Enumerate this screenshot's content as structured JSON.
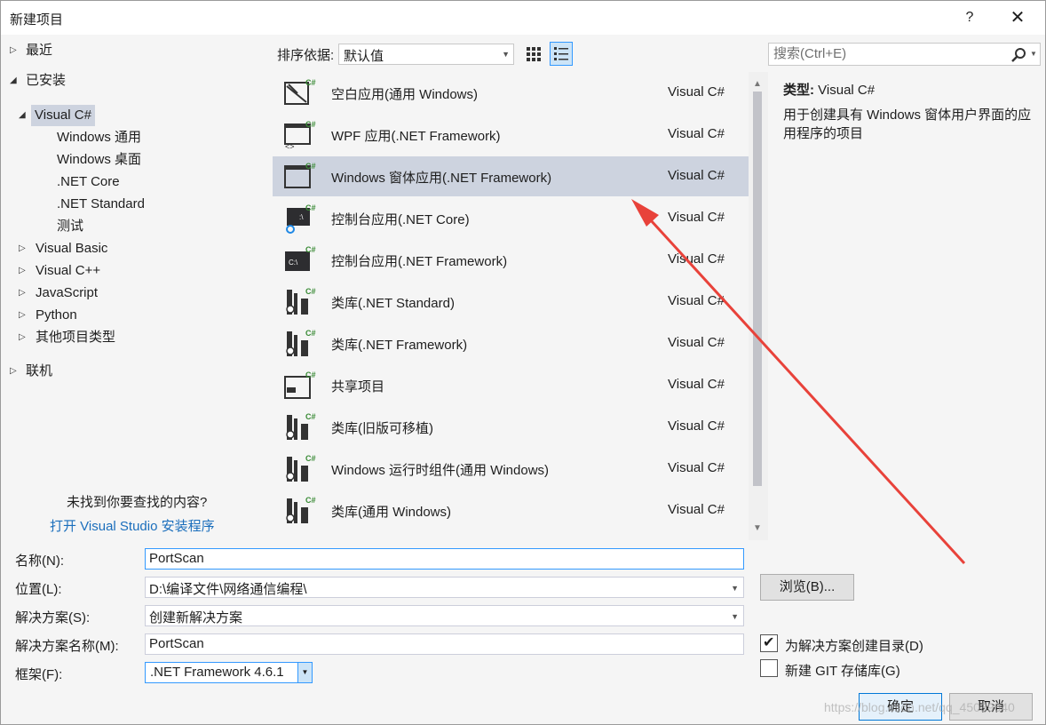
{
  "window": {
    "title": "新建项目",
    "help": "?",
    "close": "✕"
  },
  "tree": {
    "recent": "最近",
    "installed": "已安装",
    "visual_csharp": "Visual C#",
    "children": [
      "Windows 通用",
      "Windows 桌面",
      ".NET Core",
      ".NET Standard",
      "测试"
    ],
    "others": [
      "Visual Basic",
      "Visual C++",
      "JavaScript",
      "Python",
      "其他项目类型"
    ],
    "online": "联机",
    "missing_text": "未找到你要查找的内容?",
    "open_installer": "打开 Visual Studio 安装程序"
  },
  "sort": {
    "label": "排序依据:",
    "value": "默认值"
  },
  "search": {
    "placeholder": "搜索(Ctrl+E)"
  },
  "templates": [
    {
      "name": "空白应用(通用 Windows)",
      "lang": "Visual C#",
      "icon": "blank-app-icon"
    },
    {
      "name": "WPF 应用(.NET Framework)",
      "lang": "Visual C#",
      "icon": "wpf-app-icon"
    },
    {
      "name": "Windows 窗体应用(.NET Framework)",
      "lang": "Visual C#",
      "icon": "winforms-app-icon",
      "selected": true
    },
    {
      "name": "控制台应用(.NET Core)",
      "lang": "Visual C#",
      "icon": "console-core-icon"
    },
    {
      "name": "控制台应用(.NET Framework)",
      "lang": "Visual C#",
      "icon": "console-framework-icon"
    },
    {
      "name": "类库(.NET Standard)",
      "lang": "Visual C#",
      "icon": "class-library-icon"
    },
    {
      "name": "类库(.NET Framework)",
      "lang": "Visual C#",
      "icon": "class-library-icon"
    },
    {
      "name": "共享项目",
      "lang": "Visual C#",
      "icon": "shared-project-icon"
    },
    {
      "name": "类库(旧版可移植)",
      "lang": "Visual C#",
      "icon": "class-library-icon"
    },
    {
      "name": "Windows 运行时组件(通用 Windows)",
      "lang": "Visual C#",
      "icon": "runtime-component-icon"
    },
    {
      "name": "类库(通用 Windows)",
      "lang": "Visual C#",
      "icon": "class-library-icon"
    }
  ],
  "description": {
    "type_label": "类型:",
    "type_value": "Visual C#",
    "text": "用于创建具有 Windows 窗体用户界面的应用程序的项目"
  },
  "form": {
    "name_label": "名称(N):",
    "name_value": "PortScan",
    "location_label": "位置(L):",
    "location_value": "D:\\编译文件\\网络通信编程\\",
    "solution_label": "解决方案(S):",
    "solution_value": "创建新解决方案",
    "solution_name_label": "解决方案名称(M):",
    "solution_name_value": "PortScan",
    "framework_label": "框架(F):",
    "framework_value": ".NET Framework 4.6.1",
    "browse": "浏览(B)...",
    "create_dir": "为解决方案创建目录(D)",
    "create_dir_checked": true,
    "new_git": "新建 GIT 存储库(G)",
    "new_git_checked": false,
    "ok": "确定",
    "cancel": "取消"
  },
  "colors": {
    "accent": "#3399ff",
    "selection": "#cdd3df",
    "link": "#1a6ebc",
    "annotation_arrow": "#e8423a",
    "csharp_green": "#388a34"
  },
  "watermark": "https://blog.csdn.net/qq_45039640"
}
